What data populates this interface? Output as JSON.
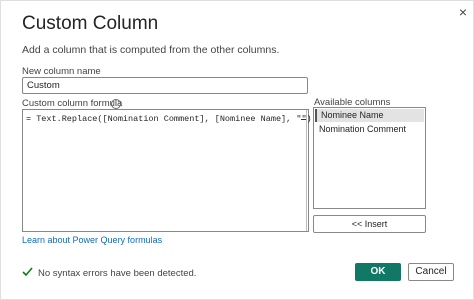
{
  "dialog": {
    "title": "Custom Column",
    "description": "Add a column that is computed from the other columns.",
    "close_icon": "×"
  },
  "new_column": {
    "label": "New column name",
    "value": "Custom"
  },
  "formula": {
    "label": "Custom column formula",
    "info_icon": "i",
    "text": "= Text.Replace([Nomination Comment], [Nominee Name], \"\")"
  },
  "available_columns": {
    "label": "Available columns",
    "items": [
      {
        "label": "Nominee Name",
        "selected": true
      },
      {
        "label": "Nomination Comment",
        "selected": false
      }
    ],
    "insert_label": "<< Insert"
  },
  "learn_link": "Learn about Power Query formulas",
  "status": {
    "text": "No syntax errors have been detected.",
    "icon": "check-icon",
    "color": "#107c10"
  },
  "buttons": {
    "ok": "OK",
    "cancel": "Cancel"
  },
  "colors": {
    "accent": "#117865",
    "link": "#0f6cbd"
  }
}
